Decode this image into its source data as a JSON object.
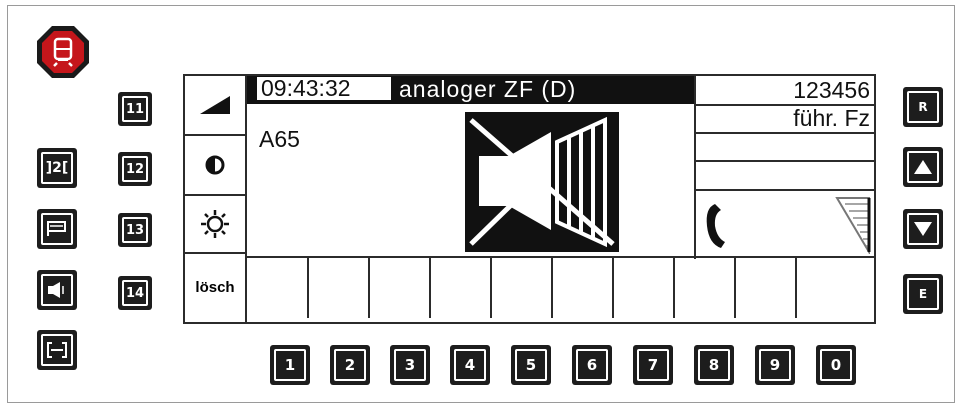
{
  "header": {
    "logo_icon": "train-stop-icon",
    "brand_color": "#c5161b"
  },
  "left_side": {
    "buttons": [
      {
        "label": "]2[",
        "icon": ""
      },
      {
        "label": "",
        "icon": "flag-icon"
      },
      {
        "label": "",
        "icon": "speaker-icon"
      },
      {
        "label": "",
        "icon": "bracket-wide-icon"
      }
    ]
  },
  "group_buttons": [
    "11",
    "12",
    "13",
    "14"
  ],
  "display": {
    "time": "09:43:32",
    "mode": "analoger ZF (D)",
    "text_left": "A65",
    "id_number": "123456",
    "role": "führ. Fz",
    "clear_label": "lösch",
    "mute_icon": "speaker-muted-icon",
    "side_icons": [
      "volume-ramp-icon",
      "contrast-icon",
      "brightness-icon"
    ],
    "call_icon": "handset-icon",
    "signal_icon": "signal-strength-icon"
  },
  "right_side": {
    "buttons": [
      "R",
      "up-arrow-icon",
      "down-arrow-icon",
      "E"
    ]
  },
  "keypad": [
    "1",
    "2",
    "3",
    "4",
    "5",
    "6",
    "7",
    "8",
    "9",
    "0"
  ]
}
